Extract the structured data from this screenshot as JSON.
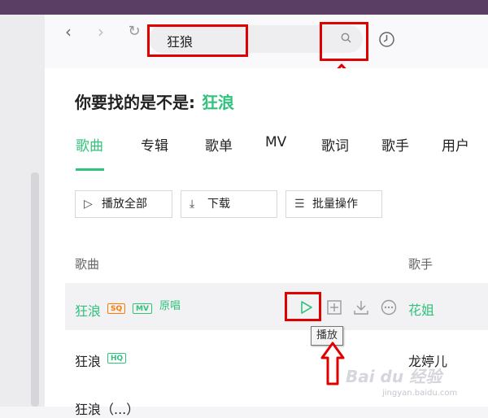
{
  "nav": {
    "search_value": "狂狼",
    "icons": [
      "back-arrow-icon",
      "forward-arrow-icon",
      "refresh-icon",
      "search-icon",
      "history-icon"
    ]
  },
  "suggest": {
    "prefix": "你要找的是不是:",
    "keyword": "狂浪"
  },
  "tabs": [
    {
      "label": "歌曲",
      "active": true
    },
    {
      "label": "专辑"
    },
    {
      "label": "歌单"
    },
    {
      "label": "MV"
    },
    {
      "label": "歌词"
    },
    {
      "label": "歌手"
    },
    {
      "label": "用户"
    }
  ],
  "actions": {
    "play_all": "播放全部",
    "download": "下载",
    "batch": "批量操作"
  },
  "list": {
    "header_song": "歌曲",
    "header_artist": "歌手",
    "rows": [
      {
        "title": "狂浪",
        "tags": [
          "SQ",
          "MV",
          "原唱"
        ],
        "artist": "花姐",
        "highlight": true
      },
      {
        "title": "狂浪",
        "tags": [
          "HQ"
        ],
        "artist": "龙婷儿"
      },
      {
        "title": "狂浪（...）",
        "tags": [],
        "artist": ""
      }
    ]
  },
  "tooltip": "播放",
  "watermark": {
    "text": "Bai du 经验",
    "sub": "jingyan.baidu.com"
  },
  "colors": {
    "accent": "#31c27c",
    "annotation": "#e00000",
    "topbar": "#5b3e63",
    "sq": "#ff7a00"
  }
}
